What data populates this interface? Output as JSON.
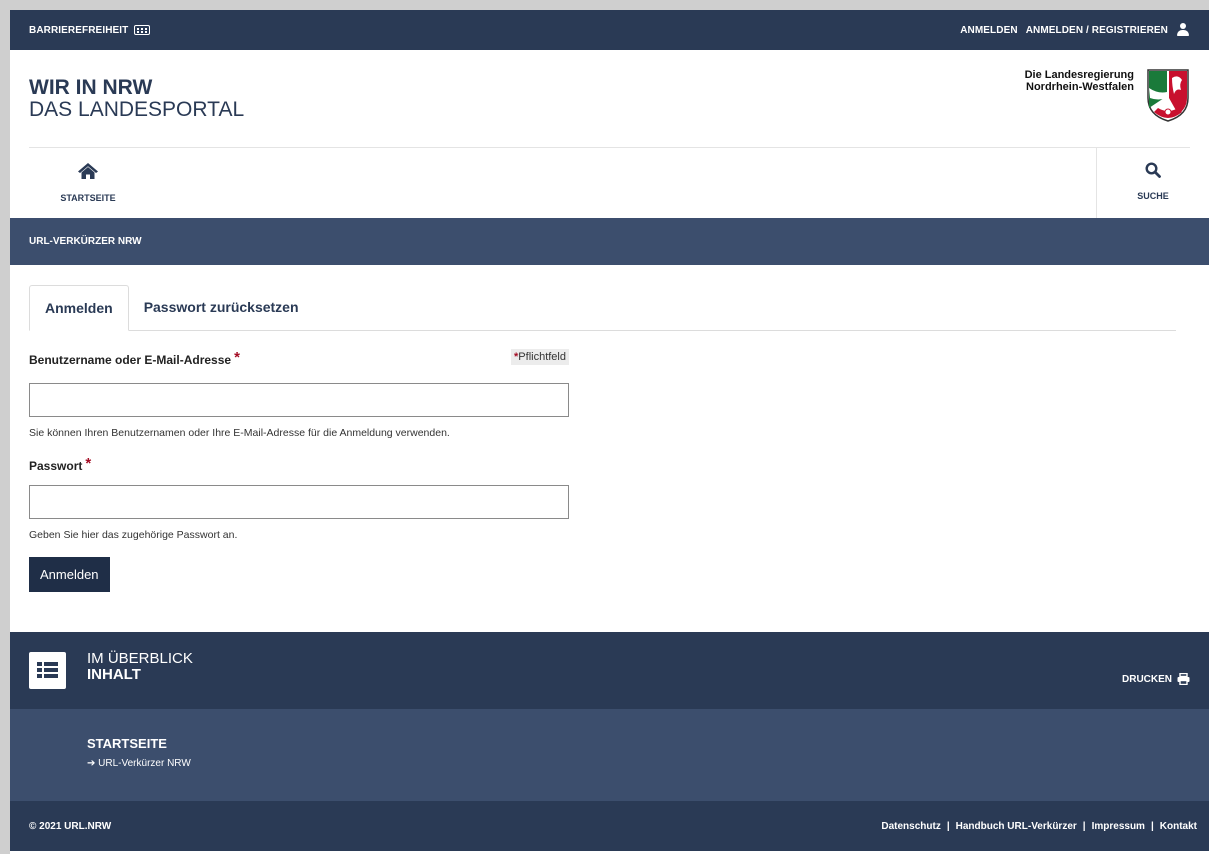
{
  "topbar": {
    "accessibility": "BARRIEREFREIHEIT",
    "login": "ANMELDEN",
    "login_register": "ANMELDEN / REGISTRIEREN"
  },
  "brand": {
    "line1": "WIR IN NRW",
    "line2": "DAS LANDESPORTAL"
  },
  "government": {
    "line1": "Die Landesregierung",
    "line2": "Nordrhein-Westfalen"
  },
  "nav": {
    "home": "STARTSEITE",
    "search": "SUCHE"
  },
  "breadcrumb": "URL-VERKÜRZER NRW",
  "tabs": [
    {
      "label": "Anmelden",
      "active": true
    },
    {
      "label": "Passwort zurücksetzen",
      "active": false
    }
  ],
  "form": {
    "username_label": "Benutzername oder E-Mail-Adresse",
    "required_marker": "*",
    "required_note": "Pflichtfeld",
    "username_value": "",
    "username_help": "Sie können Ihren Benutzernamen oder Ihre E-Mail-Adresse für die Anmeldung verwenden.",
    "password_label": "Passwort",
    "password_value": "",
    "password_help": "Geben Sie hier das zugehörige Passwort an.",
    "submit": "Anmelden"
  },
  "overview": {
    "line1": "IM ÜBERBLICK",
    "line2": "INHALT",
    "print": "DRUCKEN"
  },
  "sitemap": {
    "heading": "STARTSEITE",
    "item": "URL-Verkürzer NRW"
  },
  "footer": {
    "copyright": "© 2021 URL.NRW",
    "links": [
      "Datenschutz",
      "Handbuch URL-Verkürzer",
      "Impressum",
      "Kontakt"
    ],
    "separator": "|"
  },
  "colors": {
    "primary": "#2a3a55",
    "secondary": "#3c4e6d",
    "required": "#a40d25"
  }
}
